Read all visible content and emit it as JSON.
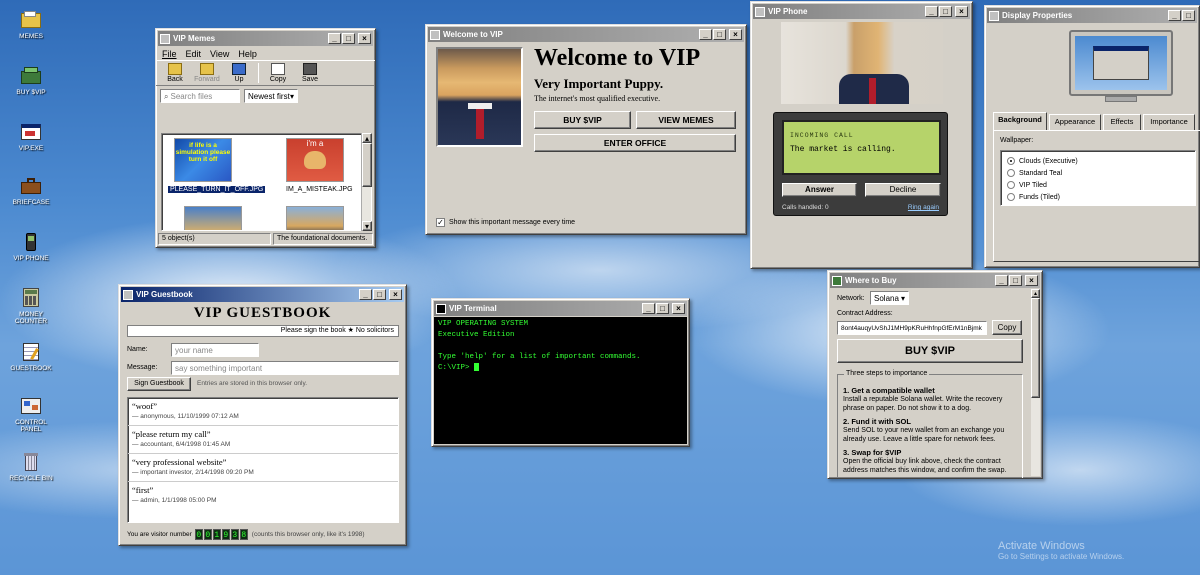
{
  "desktop": {
    "icons": [
      {
        "label": "MEMES",
        "icon": "folder-icon"
      },
      {
        "label": "BUY $VIP",
        "icon": "cash-register-icon"
      },
      {
        "label": "VIP.EXE",
        "icon": "program-icon"
      },
      {
        "label": "BRIEFCASE",
        "icon": "briefcase-icon"
      },
      {
        "label": "VIP PHONE",
        "icon": "phone-icon"
      },
      {
        "label": "MONEY COUNTER",
        "icon": "calculator-icon"
      },
      {
        "label": "GUESTBOOK",
        "icon": "notepad-icon"
      },
      {
        "label": "CONTROL PANEL",
        "icon": "control-panel-icon"
      },
      {
        "label": "RECYCLE BIN",
        "icon": "recycle-bin-icon"
      }
    ],
    "watermark": {
      "title": "Activate Windows",
      "subtitle": "Go to Settings to activate Windows."
    }
  },
  "memes": {
    "title": "VIP Memes",
    "menu": [
      "File",
      "Edit",
      "View",
      "Help"
    ],
    "toolbar": [
      "Back",
      "Forward",
      "Up",
      "Copy",
      "Save"
    ],
    "search_placeholder": "Search files",
    "sort": "Newest first",
    "files": [
      {
        "name": "PLEASE_TURN_IT_OFF.JPG",
        "thumb_text": "if life is a simulation please turn it off"
      },
      {
        "name": "IM_A_MISTEAK.JPG",
        "thumb_text": "i'm a"
      },
      {
        "name": "",
        "thumb_text": ""
      },
      {
        "name": "",
        "thumb_text": ""
      }
    ],
    "status_left": "5 object(s)",
    "status_right": "The foundational documents."
  },
  "welcome": {
    "title": "Welcome to VIP",
    "heading": "Welcome to VIP",
    "subheading": "Very Important Puppy.",
    "tagline": "The internet's most qualified executive.",
    "buttons": [
      "BUY $VIP",
      "VIEW MEMES"
    ],
    "enter": "ENTER OFFICE",
    "checkbox": "Show this important message every time"
  },
  "phone": {
    "title": "VIP Phone",
    "incoming": "INCOMING CALL",
    "message": "The market is calling.",
    "answer": "Answer",
    "decline": "Decline",
    "calls": "Calls handled: 0",
    "ring": "Ring again"
  },
  "display": {
    "title": "Display Properties",
    "tabs": [
      "Background",
      "Appearance",
      "Effects",
      "Importance"
    ],
    "wallpaper_label": "Wallpaper:",
    "options": [
      "Clouds (Executive)",
      "Standard Teal",
      "VIP Tiled",
      "Funds (Tiled)"
    ],
    "selected": 0
  },
  "guestbook": {
    "title": "VIP Guestbook",
    "heading": "VIP GUESTBOOK",
    "marquee": "Please sign the book  ★  No solicitors",
    "name_label": "Name:",
    "name_placeholder": "your name",
    "message_label": "Message:",
    "message_placeholder": "say something important",
    "sign": "Sign Guestbook",
    "note": "Entries are stored in this browser only.",
    "entries": [
      {
        "text": "“woof”",
        "meta": "— anonymous, 11/10/1999 07:12 AM"
      },
      {
        "text": "“please return my call”",
        "meta": "— accountant, 6/4/1998 01:45 AM"
      },
      {
        "text": "“very professional website”",
        "meta": "— important investor, 2/14/1998 09:20 PM"
      },
      {
        "text": "“first”",
        "meta": "— admin, 1/1/1998 05:00 PM"
      }
    ],
    "visitor_label": "You are visitor number",
    "visitor_digits": "001938",
    "visitor_note": "(counts this browser only, like it's 1998)"
  },
  "terminal": {
    "title": "VIP Terminal",
    "lines": [
      "VIP OPERATING SYSTEM",
      "Executive Edition",
      "",
      "Type 'help' for a list of important commands."
    ],
    "prompt": "C:\\VIP> "
  },
  "wheretobuy": {
    "title": "Where to Buy",
    "network_label": "Network:",
    "network": "Solana",
    "contract_label": "Contract Address:",
    "contract": "8ont4auqyUvShJ1MH9pKRuHhfnpGfErM1nBjmk",
    "copy": "Copy",
    "buy": "BUY $VIP",
    "steps_title": "Three steps to importance",
    "steps": [
      {
        "h": "1. Get a compatible wallet",
        "b": "Install a reputable Solana wallet. Write the recovery phrase on paper. Do not show it to a dog."
      },
      {
        "h": "2. Fund it with SOL",
        "b": "Send SOL to your new wallet from an exchange you already use. Leave a little spare for network fees."
      },
      {
        "h": "3. Swap for $VIP",
        "b": "Open the official buy link above, check the contract address matches this window, and confirm the swap."
      }
    ]
  }
}
